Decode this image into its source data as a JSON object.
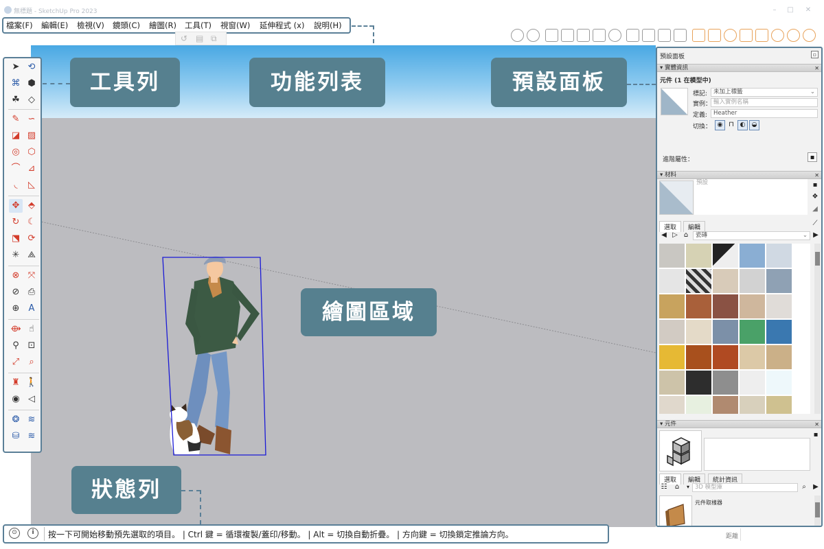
{
  "window": {
    "title": "無標題 - SketchUp Pro 2023",
    "controls": [
      "–",
      "□",
      "✕"
    ]
  },
  "menu": [
    {
      "label": "檔案(F)"
    },
    {
      "label": "編輯(E)"
    },
    {
      "label": "檢視(V)"
    },
    {
      "label": "鏡頭(C)"
    },
    {
      "label": "繪圖(R)"
    },
    {
      "label": "工具(T)"
    },
    {
      "label": "視窗(W)"
    },
    {
      "label": "延伸程式 (x)"
    },
    {
      "label": "說明(H)"
    }
  ],
  "callouts": {
    "toolbar": "工具列",
    "menu": "功能列表",
    "tray": "預設面板",
    "drawing_area": "繪圖區域",
    "status_bar": "狀態列"
  },
  "status": {
    "message": "按一下可開始移動預先選取的項目。 | Ctrl 鍵 = 循環複製/蓋印/移動。 | Alt = 切換自動折疊。 | 方向鍵 = 切換鎖定推論方向。",
    "measurements_label": "距離",
    "measurements_value": ""
  },
  "tray": {
    "title": "預設面板",
    "entity_info": {
      "header": "實體資訊",
      "summary": "元件 (1 在模型中)",
      "tag_label": "標記:",
      "tag_value": "未加上標籤",
      "instance_label": "實例：",
      "instance_placeholder": "輸入實例名稱",
      "definition_label": "定義:",
      "definition_value": "Heather",
      "toggles_label": "切換：",
      "advanced_label": "進階屬性："
    },
    "materials": {
      "header": "材料",
      "preview_name": "預設",
      "tabs": [
        "選取",
        "編輯"
      ],
      "collection": "瓷磚"
    },
    "components": {
      "header": "元件",
      "tabs": [
        "選取",
        "編輯",
        "統計資訊"
      ],
      "search_placeholder": "3D 模型庫",
      "result_label": "元件取樣器"
    }
  },
  "colors": {
    "callout_bg": "#56808f",
    "frame": "#5a7f97",
    "sky_top": "#49a8e3",
    "ground": "#bcbcc0",
    "selection": "#1a1ad6"
  }
}
